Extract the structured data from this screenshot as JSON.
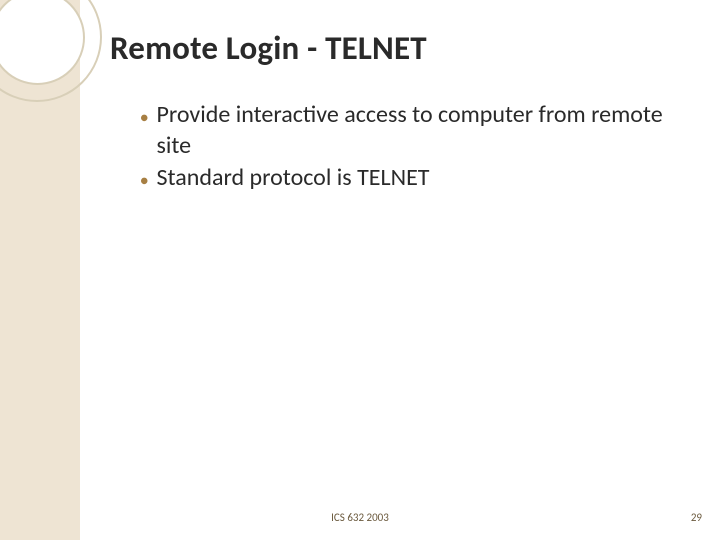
{
  "slide": {
    "title": "Remote Login - TELNET",
    "bullets": [
      "Provide interactive access to computer from remote site",
      "Standard protocol is TELNET"
    ]
  },
  "footer": {
    "center": "ICS 632 2003",
    "pageNumber": "29"
  }
}
